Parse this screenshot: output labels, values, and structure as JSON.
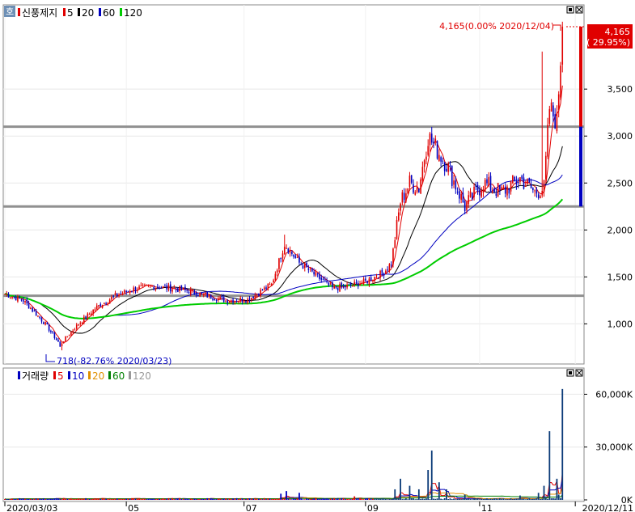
{
  "chart_data": [
    {
      "type": "candlestick",
      "title": "신풍제지",
      "ma_periods": [
        "5",
        "20",
        "60",
        "120"
      ],
      "ma_colors": [
        "#e00000",
        "#000000",
        "#0000c0",
        "#00cc00"
      ],
      "y_ticks": [
        {
          "value": 1000,
          "label": "1,000"
        },
        {
          "value": 1500,
          "label": "1,500"
        },
        {
          "value": 2000,
          "label": "2,000"
        },
        {
          "value": 2500,
          "label": "2,500"
        },
        {
          "value": 3000,
          "label": "3,000"
        },
        {
          "value": 3500,
          "label": "3,500"
        }
      ],
      "ylim": [
        590,
        4380
      ],
      "horizontal_lines": [
        1300,
        2250,
        3100
      ],
      "current_price": {
        "value": 4165,
        "label": "4,165",
        "change": "( 29.95%)"
      },
      "max_annotation": {
        "value": 4165,
        "text": "4,165(0.00% 2020/12/04)"
      },
      "min_annotation": {
        "value": 718,
        "text": "718(-82.76% 2020/03/23)"
      },
      "close_anchors": [
        [
          0,
          1320
        ],
        [
          10,
          1250
        ],
        [
          22,
          1000
        ],
        [
          30,
          780
        ],
        [
          34,
          870
        ],
        [
          40,
          1000
        ],
        [
          50,
          1180
        ],
        [
          60,
          1300
        ],
        [
          70,
          1370
        ],
        [
          80,
          1400
        ],
        [
          90,
          1380
        ],
        [
          100,
          1350
        ],
        [
          110,
          1300
        ],
        [
          120,
          1250
        ],
        [
          132,
          1260
        ],
        [
          145,
          1420
        ],
        [
          152,
          1850
        ],
        [
          160,
          1650
        ],
        [
          170,
          1500
        ],
        [
          178,
          1380
        ],
        [
          186,
          1400
        ],
        [
          196,
          1450
        ],
        [
          206,
          1550
        ],
        [
          210,
          1650
        ],
        [
          215,
          2300
        ],
        [
          220,
          2500
        ],
        [
          225,
          2450
        ],
        [
          230,
          3000
        ],
        [
          240,
          2700
        ],
        [
          250,
          2250
        ],
        [
          260,
          2500
        ],
        [
          270,
          2400
        ],
        [
          280,
          2550
        ],
        [
          288,
          2400
        ],
        [
          293,
          2450
        ],
        [
          296,
          3300
        ],
        [
          300,
          3150
        ],
        [
          303,
          4165
        ]
      ]
    },
    {
      "type": "volume",
      "title": "거래량",
      "ma_periods": [
        "5",
        "10",
        "20",
        "60",
        "120"
      ],
      "ma_colors": [
        "#e00000",
        "#0000c0",
        "#e09000",
        "#008000",
        "#999999"
      ],
      "y_ticks": [
        {
          "value": 0,
          "label": "0K"
        },
        {
          "value": 30000,
          "label": "30,000K"
        },
        {
          "value": 60000,
          "label": "60,000K"
        }
      ],
      "ylim": [
        0,
        68000
      ],
      "spikes": [
        [
          40,
          800
        ],
        [
          150,
          3500
        ],
        [
          153,
          5000
        ],
        [
          160,
          4000
        ],
        [
          190,
          2000
        ],
        [
          212,
          6000
        ],
        [
          215,
          12000
        ],
        [
          220,
          8000
        ],
        [
          225,
          6000
        ],
        [
          230,
          17000
        ],
        [
          232,
          28000
        ],
        [
          236,
          10000
        ],
        [
          240,
          6000
        ],
        [
          250,
          3000
        ],
        [
          280,
          2500
        ],
        [
          290,
          4000
        ],
        [
          293,
          8000
        ],
        [
          296,
          39000
        ],
        [
          300,
          12000
        ],
        [
          301,
          3000
        ],
        [
          303,
          63000
        ]
      ]
    }
  ],
  "x_axis": {
    "labels": [
      {
        "index": 0,
        "label": "2020/03/03"
      },
      {
        "index": 66,
        "label": "05"
      },
      {
        "index": 130,
        "label": "07"
      },
      {
        "index": 196,
        "label": "09"
      },
      {
        "index": 258,
        "label": "11"
      },
      {
        "index": 310,
        "label": "2020/12/11"
      }
    ]
  }
}
